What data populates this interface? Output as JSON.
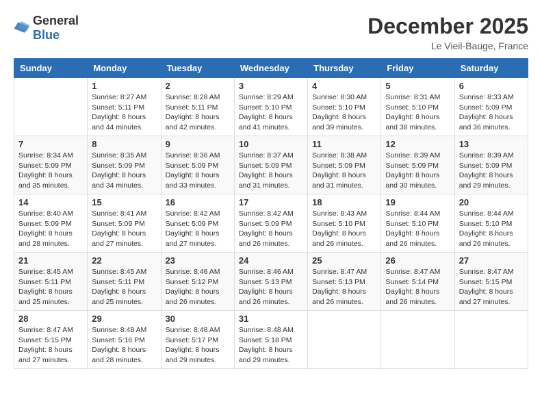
{
  "logo": {
    "general": "General",
    "blue": "Blue"
  },
  "header": {
    "month": "December 2025",
    "location": "Le Vieil-Bauge, France"
  },
  "weekdays": [
    "Sunday",
    "Monday",
    "Tuesday",
    "Wednesday",
    "Thursday",
    "Friday",
    "Saturday"
  ],
  "weeks": [
    [
      {
        "day": "",
        "sunrise": "",
        "sunset": "",
        "daylight": ""
      },
      {
        "day": "1",
        "sunrise": "Sunrise: 8:27 AM",
        "sunset": "Sunset: 5:11 PM",
        "daylight": "Daylight: 8 hours and 44 minutes."
      },
      {
        "day": "2",
        "sunrise": "Sunrise: 8:28 AM",
        "sunset": "Sunset: 5:11 PM",
        "daylight": "Daylight: 8 hours and 42 minutes."
      },
      {
        "day": "3",
        "sunrise": "Sunrise: 8:29 AM",
        "sunset": "Sunset: 5:10 PM",
        "daylight": "Daylight: 8 hours and 41 minutes."
      },
      {
        "day": "4",
        "sunrise": "Sunrise: 8:30 AM",
        "sunset": "Sunset: 5:10 PM",
        "daylight": "Daylight: 8 hours and 39 minutes."
      },
      {
        "day": "5",
        "sunrise": "Sunrise: 8:31 AM",
        "sunset": "Sunset: 5:10 PM",
        "daylight": "Daylight: 8 hours and 38 minutes."
      },
      {
        "day": "6",
        "sunrise": "Sunrise: 8:33 AM",
        "sunset": "Sunset: 5:09 PM",
        "daylight": "Daylight: 8 hours and 36 minutes."
      }
    ],
    [
      {
        "day": "7",
        "sunrise": "Sunrise: 8:34 AM",
        "sunset": "Sunset: 5:09 PM",
        "daylight": "Daylight: 8 hours and 35 minutes."
      },
      {
        "day": "8",
        "sunrise": "Sunrise: 8:35 AM",
        "sunset": "Sunset: 5:09 PM",
        "daylight": "Daylight: 8 hours and 34 minutes."
      },
      {
        "day": "9",
        "sunrise": "Sunrise: 8:36 AM",
        "sunset": "Sunset: 5:09 PM",
        "daylight": "Daylight: 8 hours and 33 minutes."
      },
      {
        "day": "10",
        "sunrise": "Sunrise: 8:37 AM",
        "sunset": "Sunset: 5:09 PM",
        "daylight": "Daylight: 8 hours and 31 minutes."
      },
      {
        "day": "11",
        "sunrise": "Sunrise: 8:38 AM",
        "sunset": "Sunset: 5:09 PM",
        "daylight": "Daylight: 8 hours and 31 minutes."
      },
      {
        "day": "12",
        "sunrise": "Sunrise: 8:39 AM",
        "sunset": "Sunset: 5:09 PM",
        "daylight": "Daylight: 8 hours and 30 minutes."
      },
      {
        "day": "13",
        "sunrise": "Sunrise: 8:39 AM",
        "sunset": "Sunset: 5:09 PM",
        "daylight": "Daylight: 8 hours and 29 minutes."
      }
    ],
    [
      {
        "day": "14",
        "sunrise": "Sunrise: 8:40 AM",
        "sunset": "Sunset: 5:09 PM",
        "daylight": "Daylight: 8 hours and 28 minutes."
      },
      {
        "day": "15",
        "sunrise": "Sunrise: 8:41 AM",
        "sunset": "Sunset: 5:09 PM",
        "daylight": "Daylight: 8 hours and 27 minutes."
      },
      {
        "day": "16",
        "sunrise": "Sunrise: 8:42 AM",
        "sunset": "Sunset: 5:09 PM",
        "daylight": "Daylight: 8 hours and 27 minutes."
      },
      {
        "day": "17",
        "sunrise": "Sunrise: 8:42 AM",
        "sunset": "Sunset: 5:09 PM",
        "daylight": "Daylight: 8 hours and 26 minutes."
      },
      {
        "day": "18",
        "sunrise": "Sunrise: 8:43 AM",
        "sunset": "Sunset: 5:10 PM",
        "daylight": "Daylight: 8 hours and 26 minutes."
      },
      {
        "day": "19",
        "sunrise": "Sunrise: 8:44 AM",
        "sunset": "Sunset: 5:10 PM",
        "daylight": "Daylight: 8 hours and 26 minutes."
      },
      {
        "day": "20",
        "sunrise": "Sunrise: 8:44 AM",
        "sunset": "Sunset: 5:10 PM",
        "daylight": "Daylight: 8 hours and 26 minutes."
      }
    ],
    [
      {
        "day": "21",
        "sunrise": "Sunrise: 8:45 AM",
        "sunset": "Sunset: 5:11 PM",
        "daylight": "Daylight: 8 hours and 25 minutes."
      },
      {
        "day": "22",
        "sunrise": "Sunrise: 8:45 AM",
        "sunset": "Sunset: 5:11 PM",
        "daylight": "Daylight: 8 hours and 25 minutes."
      },
      {
        "day": "23",
        "sunrise": "Sunrise: 8:46 AM",
        "sunset": "Sunset: 5:12 PM",
        "daylight": "Daylight: 8 hours and 26 minutes."
      },
      {
        "day": "24",
        "sunrise": "Sunrise: 8:46 AM",
        "sunset": "Sunset: 5:13 PM",
        "daylight": "Daylight: 8 hours and 26 minutes."
      },
      {
        "day": "25",
        "sunrise": "Sunrise: 8:47 AM",
        "sunset": "Sunset: 5:13 PM",
        "daylight": "Daylight: 8 hours and 26 minutes."
      },
      {
        "day": "26",
        "sunrise": "Sunrise: 8:47 AM",
        "sunset": "Sunset: 5:14 PM",
        "daylight": "Daylight: 8 hours and 26 minutes."
      },
      {
        "day": "27",
        "sunrise": "Sunrise: 8:47 AM",
        "sunset": "Sunset: 5:15 PM",
        "daylight": "Daylight: 8 hours and 27 minutes."
      }
    ],
    [
      {
        "day": "28",
        "sunrise": "Sunrise: 8:47 AM",
        "sunset": "Sunset: 5:15 PM",
        "daylight": "Daylight: 8 hours and 27 minutes."
      },
      {
        "day": "29",
        "sunrise": "Sunrise: 8:48 AM",
        "sunset": "Sunset: 5:16 PM",
        "daylight": "Daylight: 8 hours and 28 minutes."
      },
      {
        "day": "30",
        "sunrise": "Sunrise: 8:48 AM",
        "sunset": "Sunset: 5:17 PM",
        "daylight": "Daylight: 8 hours and 29 minutes."
      },
      {
        "day": "31",
        "sunrise": "Sunrise: 8:48 AM",
        "sunset": "Sunset: 5:18 PM",
        "daylight": "Daylight: 8 hours and 29 minutes."
      },
      {
        "day": "",
        "sunrise": "",
        "sunset": "",
        "daylight": ""
      },
      {
        "day": "",
        "sunrise": "",
        "sunset": "",
        "daylight": ""
      },
      {
        "day": "",
        "sunrise": "",
        "sunset": "",
        "daylight": ""
      }
    ]
  ]
}
